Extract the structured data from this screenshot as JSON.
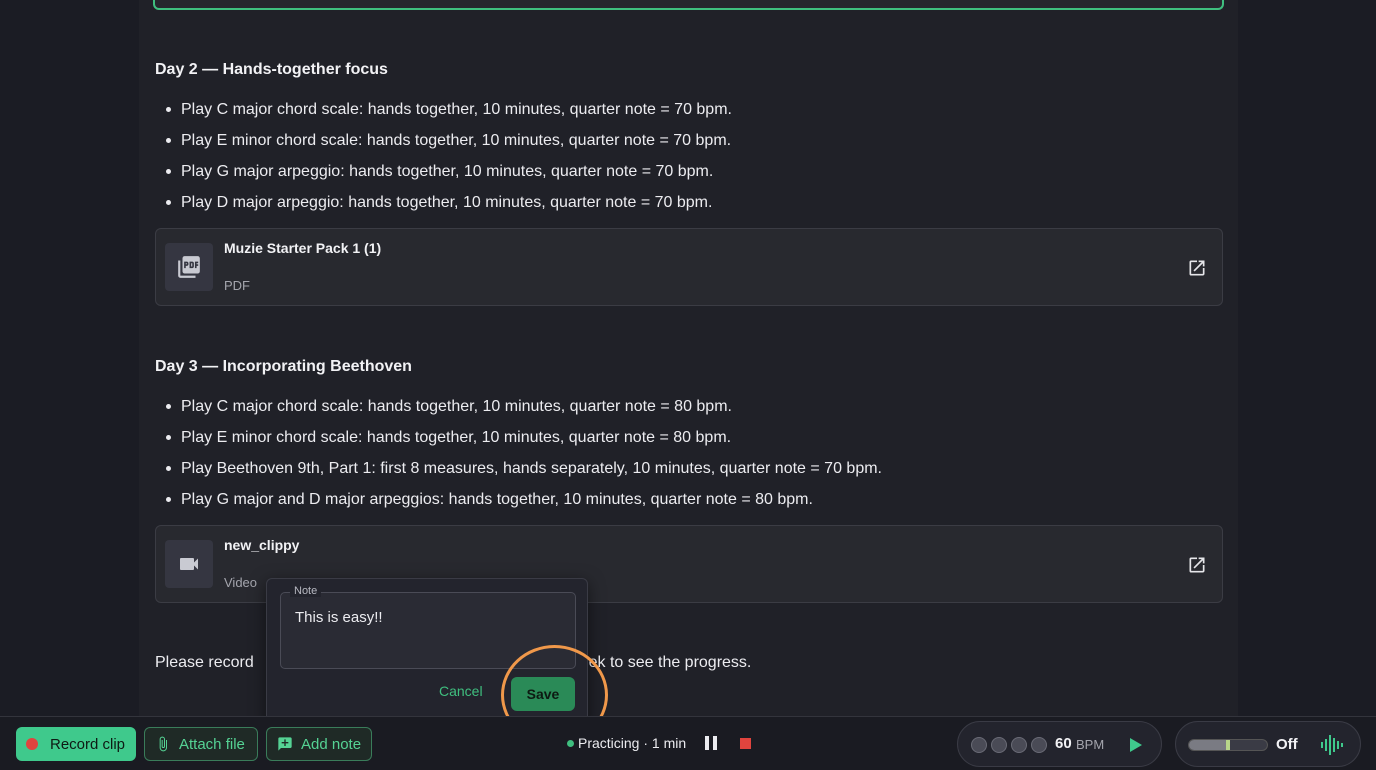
{
  "day2": {
    "title": "Day 2 — Hands-together focus",
    "tasks": [
      "Play C major chord scale: hands together, 10 minutes, quarter note = 70 bpm.",
      "Play E minor chord scale: hands together, 10 minutes, quarter note = 70 bpm.",
      "Play G major arpeggio: hands together, 10 minutes, quarter note = 70 bpm.",
      "Play D major arpeggio: hands together, 10 minutes, quarter note = 70 bpm."
    ],
    "attachment": {
      "name": "Muzie Starter Pack 1 (1)",
      "kind": "PDF",
      "icon": "pdf-icon"
    }
  },
  "day3": {
    "title": "Day 3 — Incorporating Beethoven",
    "tasks": [
      "Play C major chord scale: hands together, 10 minutes, quarter note = 80 bpm.",
      "Play E minor chord scale: hands together, 10 minutes, quarter note = 80 bpm.",
      "Play Beethoven 9th, Part 1: first 8 measures, hands separately, 10 minutes, quarter note = 70 bpm.",
      "Play G major and D major arpeggios: hands together, 10 minutes, quarter note = 80 bpm."
    ],
    "attachment": {
      "name": "new_clippy",
      "kind": "Video",
      "icon": "video-camera-icon"
    }
  },
  "closing": {
    "start": "Please record",
    "end": "eek to see the progress."
  },
  "note_popover": {
    "legend": "Note",
    "value": "This is easy!!",
    "cancel_label": "Cancel",
    "save_label": "Save"
  },
  "bottombar": {
    "record_label": "Record clip",
    "attach_label": "Attach file",
    "note_label": "Add note",
    "status_text": "Practicing · 1 min",
    "metronome": {
      "bpm": "60",
      "unit": "BPM",
      "beats": 4
    },
    "drone": {
      "state": "Off",
      "level": 0.5
    }
  },
  "colors": {
    "accent": "#3fc98c",
    "record": "#e0443e",
    "highlight": "#f0984a"
  }
}
